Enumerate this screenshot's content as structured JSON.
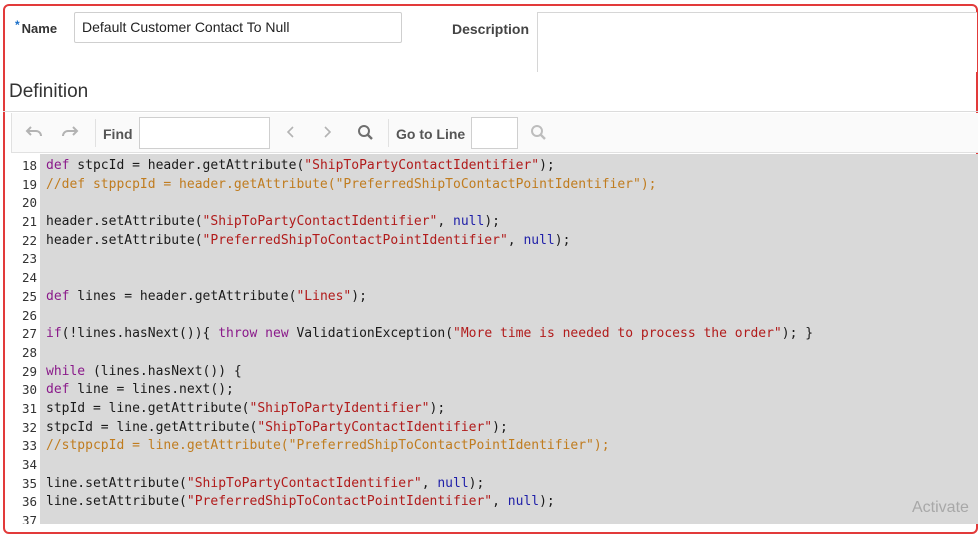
{
  "form": {
    "name_required_marker": "*",
    "name_label": "Name",
    "name_value": "Default Customer Contact To Null",
    "description_label": "Description",
    "description_value": ""
  },
  "definition": {
    "heading": "Definition"
  },
  "toolbar": {
    "undo_icon": "undo-icon",
    "redo_icon": "redo-icon",
    "find_label": "Find",
    "find_value": "",
    "prev_icon": "chevron-left-icon",
    "next_icon": "chevron-right-icon",
    "search_icon": "search-icon",
    "goto_label": "Go to Line",
    "goto_value": "",
    "goto_search_icon": "search-icon"
  },
  "editor": {
    "lines": [
      {
        "n": "18",
        "tokens": [
          {
            "t": "kw",
            "v": "def"
          },
          {
            "t": "p",
            "v": " stpcId = header.getAttribute("
          },
          {
            "t": "str",
            "v": "\"ShipToPartyContactIdentifier\""
          },
          {
            "t": "p",
            "v": ");"
          }
        ]
      },
      {
        "n": "19",
        "tokens": [
          {
            "t": "cm",
            "v": "//def stppcpId = header.getAttribute(\"PreferredShipToContactPointIdentifier\");"
          }
        ]
      },
      {
        "n": "20",
        "tokens": []
      },
      {
        "n": "21",
        "tokens": [
          {
            "t": "p",
            "v": "header.setAttribute("
          },
          {
            "t": "str",
            "v": "\"ShipToPartyContactIdentifier\""
          },
          {
            "t": "p",
            "v": ", "
          },
          {
            "t": "nl",
            "v": "null"
          },
          {
            "t": "p",
            "v": ");"
          }
        ]
      },
      {
        "n": "22",
        "tokens": [
          {
            "t": "p",
            "v": "header.setAttribute("
          },
          {
            "t": "str",
            "v": "\"PreferredShipToContactPointIdentifier\""
          },
          {
            "t": "p",
            "v": ", "
          },
          {
            "t": "nl",
            "v": "null"
          },
          {
            "t": "p",
            "v": ");"
          }
        ]
      },
      {
        "n": "23",
        "tokens": []
      },
      {
        "n": "24",
        "tokens": []
      },
      {
        "n": "25",
        "tokens": [
          {
            "t": "kw",
            "v": "def"
          },
          {
            "t": "p",
            "v": " lines = header.getAttribute("
          },
          {
            "t": "str",
            "v": "\"Lines\""
          },
          {
            "t": "p",
            "v": ");"
          }
        ]
      },
      {
        "n": "26",
        "tokens": []
      },
      {
        "n": "27",
        "tokens": [
          {
            "t": "kw",
            "v": "if"
          },
          {
            "t": "p",
            "v": "(!lines.hasNext()){ "
          },
          {
            "t": "kw",
            "v": "throw"
          },
          {
            "t": "p",
            "v": " "
          },
          {
            "t": "kw",
            "v": "new"
          },
          {
            "t": "p",
            "v": " ValidationException("
          },
          {
            "t": "str",
            "v": "\"More time is needed to process the order\""
          },
          {
            "t": "p",
            "v": "); }"
          }
        ]
      },
      {
        "n": "28",
        "tokens": []
      },
      {
        "n": "29",
        "tokens": [
          {
            "t": "kw",
            "v": "while"
          },
          {
            "t": "p",
            "v": " (lines.hasNext()) {"
          }
        ]
      },
      {
        "n": "30",
        "tokens": [
          {
            "t": "kw",
            "v": "def"
          },
          {
            "t": "p",
            "v": " line = lines.next();"
          }
        ]
      },
      {
        "n": "31",
        "tokens": [
          {
            "t": "p",
            "v": "stpId = line.getAttribute("
          },
          {
            "t": "str",
            "v": "\"ShipToPartyIdentifier\""
          },
          {
            "t": "p",
            "v": ");"
          }
        ]
      },
      {
        "n": "32",
        "tokens": [
          {
            "t": "p",
            "v": "stpcId = line.getAttribute("
          },
          {
            "t": "str",
            "v": "\"ShipToPartyContactIdentifier\""
          },
          {
            "t": "p",
            "v": ");"
          }
        ]
      },
      {
        "n": "33",
        "tokens": [
          {
            "t": "cm",
            "v": "//stppcpId = line.getAttribute(\"PreferredShipToContactPointIdentifier\");"
          }
        ]
      },
      {
        "n": "34",
        "tokens": []
      },
      {
        "n": "35",
        "tokens": [
          {
            "t": "p",
            "v": "line.setAttribute("
          },
          {
            "t": "str",
            "v": "\"ShipToPartyContactIdentifier\""
          },
          {
            "t": "p",
            "v": ", "
          },
          {
            "t": "nl",
            "v": "null"
          },
          {
            "t": "p",
            "v": ");"
          }
        ]
      },
      {
        "n": "36",
        "tokens": [
          {
            "t": "p",
            "v": "line.setAttribute("
          },
          {
            "t": "str",
            "v": "\"PreferredShipToContactPointIdentifier\""
          },
          {
            "t": "p",
            "v": ", "
          },
          {
            "t": "nl",
            "v": "null"
          },
          {
            "t": "p",
            "v": ");"
          }
        ]
      },
      {
        "n": "37",
        "tokens": []
      }
    ]
  },
  "watermark": "Activate"
}
